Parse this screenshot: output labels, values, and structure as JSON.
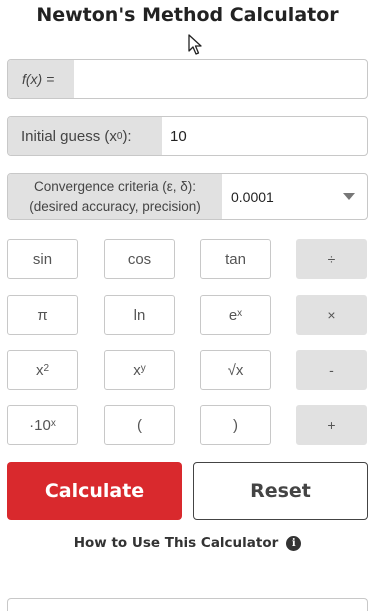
{
  "title": "Newton's Method Calculator",
  "fx": {
    "label": "f(x) =",
    "value": ""
  },
  "initial_guess": {
    "label_main": "Initial guess (x",
    "label_sub": "0",
    "label_end": "):",
    "value": "10"
  },
  "convergence": {
    "label_line1": "Convergence criteria (ε, δ):",
    "label_line2": "(desired accuracy, precision)",
    "selected": "0.0001"
  },
  "keypad": {
    "sin": "sin",
    "cos": "cos",
    "tan": "tan",
    "divide": "÷",
    "pi": "π",
    "ln": "ln",
    "e_base": "e",
    "e_sup": "x",
    "multiply": "×",
    "sq_base": "x",
    "sq_sup": "2",
    "pow_base": "x",
    "pow_sup": "y",
    "sqrt": "√x",
    "minus": "-",
    "sci_base": "·10",
    "sci_sup": "x",
    "lparen": "(",
    "rparen": ")",
    "plus": "+"
  },
  "actions": {
    "calculate": "Calculate",
    "reset": "Reset"
  },
  "how_to": {
    "label": "How to Use This Calculator",
    "icon": "i"
  },
  "colors": {
    "calculate_bg": "#d9292d",
    "label_bg": "#e1e1e1",
    "operator_bg": "#e1e1e1"
  }
}
